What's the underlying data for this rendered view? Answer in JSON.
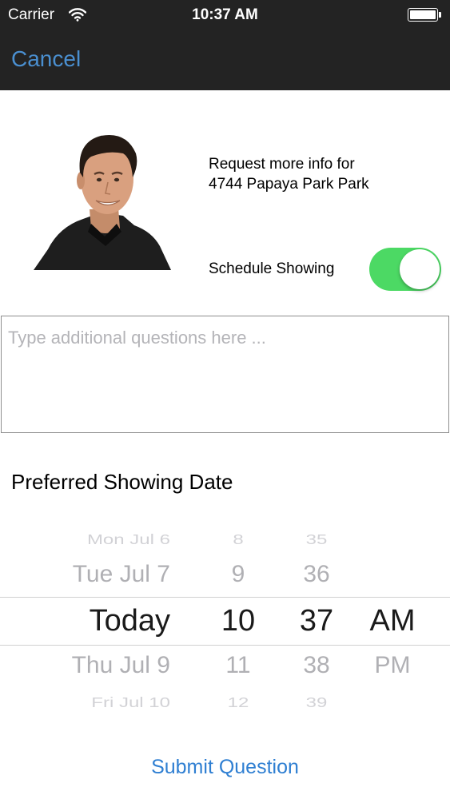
{
  "status_bar": {
    "carrier": "Carrier",
    "time": "10:37 AM",
    "wifi_icon": "wifi-icon",
    "battery_icon": "battery-icon"
  },
  "nav": {
    "cancel_label": "Cancel",
    "accent_color": "#4a8fd0"
  },
  "agent": {
    "avatar_icon": "agent-photo",
    "request_line1": "Request more info for",
    "request_line2": "4744 Papaya Park Park"
  },
  "schedule": {
    "label": "Schedule Showing",
    "enabled": true,
    "toggle_color": "#4cd964"
  },
  "questions": {
    "placeholder": "Type additional questions here ...",
    "value": ""
  },
  "preferred_date": {
    "title": "Preferred Showing Date",
    "picker": {
      "dates": [
        "Mon Jul 6",
        "Tue Jul 7",
        "Today",
        "Thu Jul 9",
        "Fri Jul 10"
      ],
      "hours": [
        "8",
        "9",
        "10",
        "11",
        "12"
      ],
      "minutes": [
        "35",
        "36",
        "37",
        "38",
        "39"
      ],
      "ampm": [
        "AM",
        "PM"
      ],
      "selected": {
        "date": "Today",
        "hour": "10",
        "minute": "37",
        "ampm": "AM"
      }
    }
  },
  "submit": {
    "label": "Submit Question",
    "color": "#2f7fd2"
  }
}
